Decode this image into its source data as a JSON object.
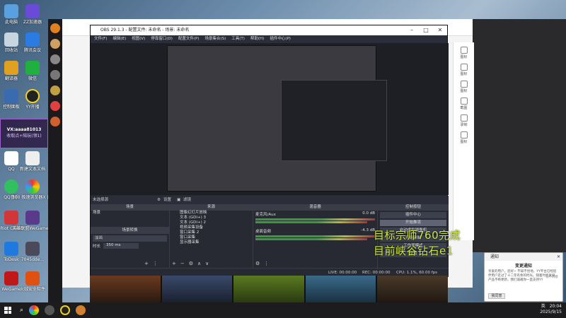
{
  "desktop": {
    "icons": [
      {
        "label": "此电脑"
      },
      {
        "label": "ZZ加速器"
      },
      {
        "label": "回收站"
      },
      {
        "label": "腾讯会议"
      },
      {
        "label": "翻译器"
      },
      {
        "label": "微信"
      },
      {
        "label": "控制面板"
      },
      {
        "label": "YY开播"
      },
      {
        "label": "QQ"
      },
      {
        "label": "新建文本文档"
      },
      {
        "label": "QQ音乐"
      },
      {
        "label": "360 极速浏览器X (2)"
      },
      {
        "label": "Riot Client"
      },
      {
        "label": "英雄联盟WeGame版"
      },
      {
        "label": "ToDesk"
      },
      {
        "label": "7045dde..."
      },
      {
        "label": "WeGame"
      },
      {
        "label": "火绒安全软件"
      }
    ],
    "overlay_banner": {
      "line1": "VX:aaaa81013",
      "line2": "收取点+陪玩(领1)"
    }
  },
  "obs": {
    "title": "OBS 29.1.3 - 配置文件: 未命名 - 场景: 未命名",
    "menu": [
      "文件(F)",
      "编辑(E)",
      "视图(V)",
      "停靠窗口(D)",
      "配置文件(P)",
      "场景集合(S)",
      "工具(T)",
      "帮助(H)",
      "插件中心(P)"
    ],
    "preview_status": {
      "source_label": "未选择源",
      "settings_label": "设置",
      "filters_label": "滤镜"
    },
    "scenes": {
      "header": "场景",
      "items": [
        "场景"
      ]
    },
    "transitions": {
      "header": "场景转换",
      "type": "淡出",
      "duration_label": "时长",
      "duration_value": "350 ms"
    },
    "sources": {
      "header": "来源",
      "items": [
        "图像幻灯片放映",
        "文本 (GDI+) 3",
        "文本 (GDI+) 2",
        "视频采集设备",
        "窗口采集 2",
        "窗口采集",
        "显示器采集"
      ]
    },
    "mixer": {
      "header": "混音器",
      "channels": [
        {
          "name": "麦克风/Aux",
          "db": "0.0 dB"
        },
        {
          "name": "桌面音频",
          "db": "-4.3 dB"
        }
      ]
    },
    "controls": {
      "header": "控制按钮",
      "buttons": [
        "插件中心",
        "开始推流",
        "启动虚拟摄像机",
        "开始录制",
        "工作室模式",
        "设置"
      ],
      "highlighted": "开始推流"
    },
    "status": {
      "live": "LIVE: 00:00:00",
      "rec": "REC: 00:00:00",
      "cpu": "CPU: 1.1%, 60.00 fps"
    }
  },
  "overlay_text": {
    "line1": "目标宗师760完成",
    "line2": "目前峡谷钻石e1"
  },
  "right_toolbar": {
    "items": [
      "图标",
      "图标",
      "图标",
      "截图",
      "录制",
      "图标"
    ]
  },
  "notification": {
    "app": "通知",
    "title": "变更通知",
    "body": "亲爱的用户，您好~ 不知不觉地，YY平台已经陪伴用户走过了十二年有余的时光。随着时代发展，产品不断更新，我们诚邀你一直支持YY",
    "button": "我同意",
    "link": "我不同意"
  },
  "taskbar": {
    "time": "20:04",
    "date": "2025/9/15",
    "lang": "英"
  },
  "colors": {
    "obs_bg": "#272a33",
    "overlay_green": "#cfe83a",
    "meter_green": "#3a9a3a"
  }
}
